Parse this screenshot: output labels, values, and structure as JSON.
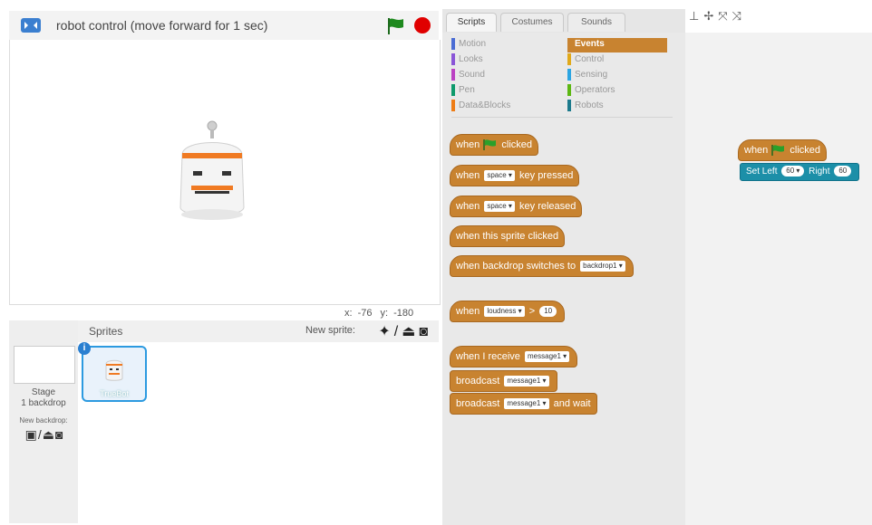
{
  "stage": {
    "title": "robot control (move forward for 1 sec)",
    "mouse_x_label": "x:",
    "mouse_x": "-76",
    "mouse_y_label": "y:",
    "mouse_y": "-180"
  },
  "backdrops": {
    "stage_label": "Stage",
    "backdrop_count": "1 backdrop",
    "new_backdrop_label": "New backdrop:"
  },
  "sprites": {
    "header_label": "Sprites",
    "new_sprite_label": "New sprite:",
    "items": [
      {
        "name": "TrueBot",
        "info": "i"
      }
    ]
  },
  "tabs": [
    {
      "label": "Scripts"
    },
    {
      "label": "Costumes"
    },
    {
      "label": "Sounds"
    }
  ],
  "categories": [
    {
      "label": "Motion",
      "color": "#4a6cd4"
    },
    {
      "label": "Events",
      "color": "#c88330"
    },
    {
      "label": "Looks",
      "color": "#8a55d7"
    },
    {
      "label": "Control",
      "color": "#e1a91a"
    },
    {
      "label": "Sound",
      "color": "#bb42c3"
    },
    {
      "label": "Sensing",
      "color": "#2ca5e2"
    },
    {
      "label": "Pen",
      "color": "#0e9a6c"
    },
    {
      "label": "Operators",
      "color": "#5cb712"
    },
    {
      "label": "Data&Blocks",
      "color": "#ee7d16"
    },
    {
      "label": "Robots",
      "color": "#1c7a8c"
    }
  ],
  "blocks": {
    "when_flag": {
      "pre": "when",
      "post": "clicked"
    },
    "when_key_pressed": {
      "pre": "when",
      "input": "space ▾",
      "post": "key pressed"
    },
    "when_key_released": {
      "pre": "when",
      "input": "space ▾",
      "post": "key released"
    },
    "when_sprite_clicked": {
      "text": "when this sprite clicked"
    },
    "when_backdrop": {
      "pre": "when backdrop switches to",
      "input": "backdrop1 ▾"
    },
    "when_loudness": {
      "pre": "when",
      "input": "loudness ▾",
      "op": ">",
      "value": "10"
    },
    "when_receive": {
      "pre": "when I receive",
      "input": "message1 ▾"
    },
    "broadcast": {
      "pre": "broadcast",
      "input": "message1 ▾"
    },
    "broadcast_wait": {
      "pre": "broadcast",
      "input": "message1 ▾",
      "post": "and wait"
    }
  },
  "script": {
    "hat": {
      "pre": "when",
      "post": "clicked"
    },
    "set_block": {
      "left_label": "Set Left",
      "left_value": "60 ▾",
      "right_label": "Right",
      "right_value": "60"
    }
  },
  "colors": {
    "events": "#c88330",
    "robots": "#1c8fa8",
    "stop": "#e00000",
    "flag": "#1e8a1e",
    "selection": "#2c9ae0"
  }
}
